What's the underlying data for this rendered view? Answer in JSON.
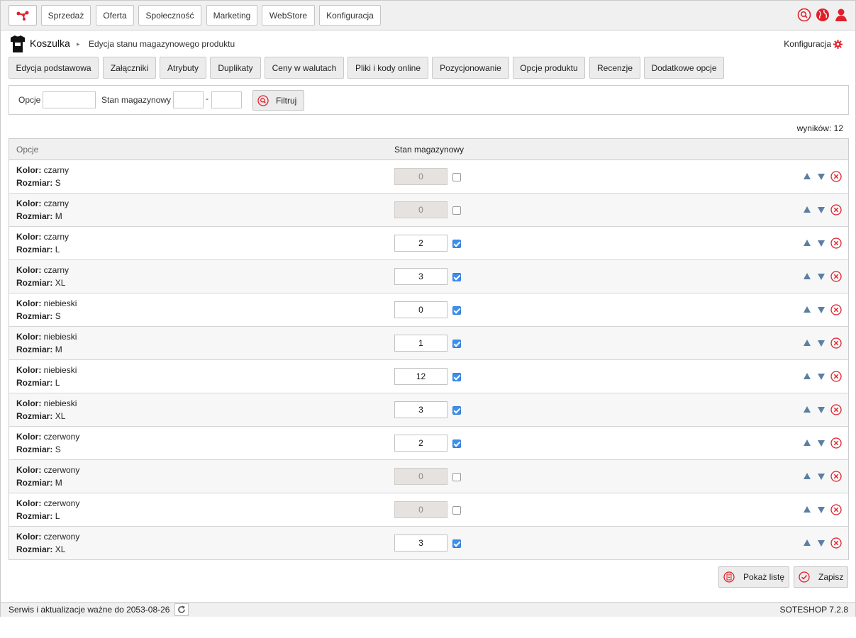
{
  "nav": {
    "items": [
      "Sprzedaż",
      "Oferta",
      "Społeczność",
      "Marketing",
      "WebStore",
      "Konfiguracja"
    ]
  },
  "breadcrumb": {
    "title": "Koszulka",
    "separator": "▸",
    "subtitle": "Edycja stanu magazynowego produktu",
    "config_label": "Konfiguracja"
  },
  "tabs": [
    "Edycja podstawowa",
    "Załączniki",
    "Atrybuty",
    "Duplikaty",
    "Ceny w walutach",
    "Pliki i kody online",
    "Pozycjonowanie",
    "Opcje produktu",
    "Recenzje",
    "Dodatkowe opcje"
  ],
  "filter": {
    "options_label": "Opcje",
    "options_value": "",
    "stock_label": "Stan magazynowy",
    "stock_from": "",
    "range_sep": "-",
    "stock_to": "",
    "button_label": "Filtruj"
  },
  "results_label": "wyników: 12",
  "table": {
    "headers": {
      "options": "Opcje",
      "stock": "Stan magazynowy"
    },
    "color_label": "Kolor:",
    "size_label": "Rozmiar:",
    "rows": [
      {
        "color": "czarny",
        "size": "S",
        "stock": "0",
        "active": false
      },
      {
        "color": "czarny",
        "size": "M",
        "stock": "0",
        "active": false
      },
      {
        "color": "czarny",
        "size": "L",
        "stock": "2",
        "active": true
      },
      {
        "color": "czarny",
        "size": "XL",
        "stock": "3",
        "active": true
      },
      {
        "color": "niebieski",
        "size": "S",
        "stock": "0",
        "active": true
      },
      {
        "color": "niebieski",
        "size": "M",
        "stock": "1",
        "active": true
      },
      {
        "color": "niebieski",
        "size": "L",
        "stock": "12",
        "active": true
      },
      {
        "color": "niebieski",
        "size": "XL",
        "stock": "3",
        "active": true
      },
      {
        "color": "czerwony",
        "size": "S",
        "stock": "2",
        "active": true
      },
      {
        "color": "czerwony",
        "size": "M",
        "stock": "0",
        "active": false
      },
      {
        "color": "czerwony",
        "size": "L",
        "stock": "0",
        "active": false
      },
      {
        "color": "czerwony",
        "size": "XL",
        "stock": "3",
        "active": true
      }
    ]
  },
  "actions": {
    "list_label": "Pokaż listę",
    "save_label": "Zapisz"
  },
  "footer": {
    "license_text": "Serwis i aktualizacje ważne do 2053-08-26",
    "version": "SOTESHOP 7.2.8"
  },
  "colors": {
    "accent": "#e0202a",
    "arrow": "#5b7fa3",
    "checkbox": "#3b8ff0"
  }
}
